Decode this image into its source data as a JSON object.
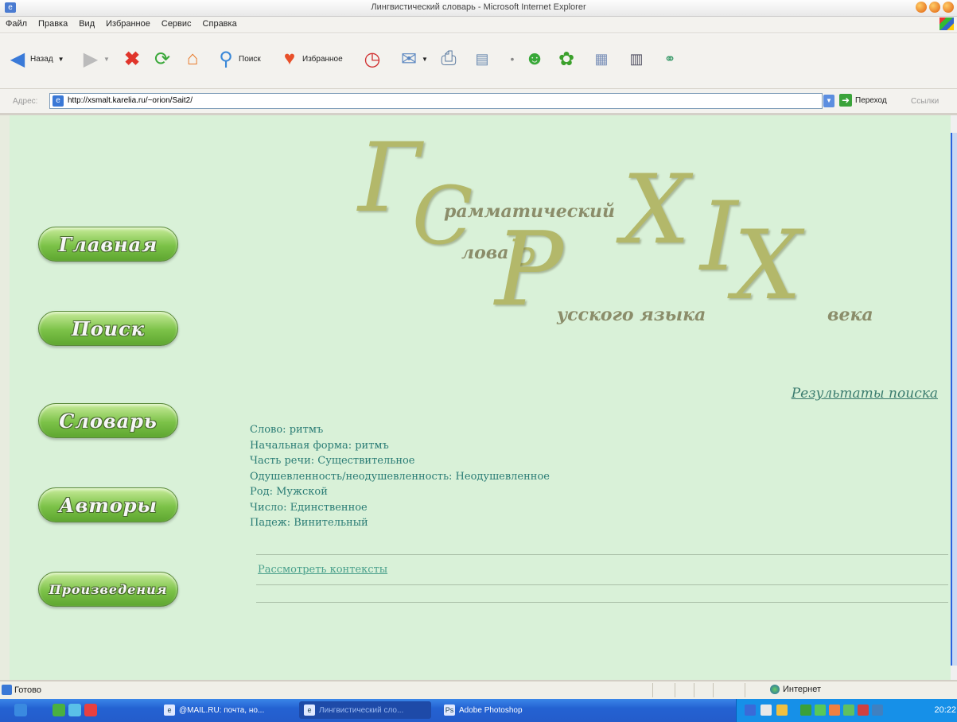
{
  "window": {
    "title": "Лингвистический словарь - Microsoft Internet Explorer"
  },
  "menu": [
    "Файл",
    "Правка",
    "Вид",
    "Избранное",
    "Сервис",
    "Справка"
  ],
  "toolbar": {
    "back_label": "Назад",
    "search_label": "Поиск",
    "favorites_label": "Избранное"
  },
  "address_bar": {
    "label": "Адрес:",
    "url": "http://xsmalt.karelia.ru/~orion/Sait2/",
    "go_label": "Переход",
    "links_label": "Ссылки"
  },
  "logo": {
    "big_g": "Г",
    "line1": "рамматический",
    "big_s": "С",
    "line2": "лова",
    "small_b": "ь",
    "big_r": "Р",
    "line3": "усского языка",
    "roman": [
      "X",
      "I",
      "X"
    ],
    "century": "века"
  },
  "nav": [
    {
      "label": "Главная"
    },
    {
      "label": "Поиск"
    },
    {
      "label": "Словарь"
    },
    {
      "label": "Авторы"
    },
    {
      "label": "Произведения"
    }
  ],
  "results": {
    "heading": "Результаты поиска",
    "fields": [
      "Слово: ритмъ",
      "Начальная форма: ритмъ",
      "Часть речи: Существительное",
      "Одушевленность/неодушевленность: Неодушевленное",
      "Род: Мужской",
      "Число: Единственное",
      "Падеж: Винительный"
    ],
    "context_link": "Рассмотреть контексты"
  },
  "status": {
    "text": "Готово",
    "zone": "Интернет"
  },
  "taskbar": {
    "tasks": [
      {
        "label": "@MAIL.RU: почта, но..."
      },
      {
        "label": "Лингвистический сло..."
      },
      {
        "label": "Adobe Photoshop"
      }
    ],
    "clock": "20:22"
  }
}
